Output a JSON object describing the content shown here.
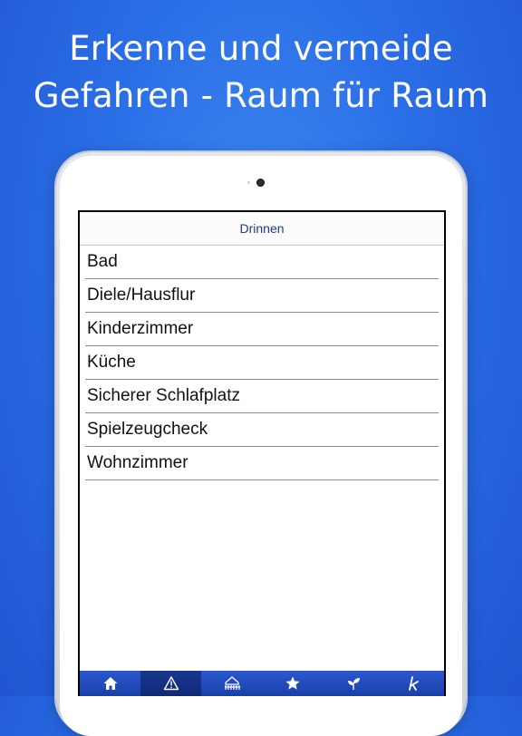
{
  "headline": {
    "line1": "Erkenne und vermeide",
    "line2": "Gefahren - Raum für Raum"
  },
  "screen": {
    "nav_title": "Drinnen",
    "items": [
      "Bad",
      "Diele/Hausflur",
      "Kinderzimmer",
      "Küche",
      "Sicherer Schlafplatz",
      "Spielzeugcheck",
      "Wohnzimmer"
    ],
    "tabs": [
      {
        "icon": "home-icon",
        "active": false
      },
      {
        "icon": "warning-icon",
        "active": true
      },
      {
        "icon": "house-fence-icon",
        "active": false
      },
      {
        "icon": "star-icon",
        "active": false
      },
      {
        "icon": "sprout-icon",
        "active": false
      },
      {
        "icon": "k-letter-icon",
        "active": false
      }
    ]
  },
  "colors": {
    "background": "#2a6ee6",
    "nav_title": "#1c3d8f",
    "tabbar": "#1f4ab9",
    "tab_active": "#12307f"
  }
}
